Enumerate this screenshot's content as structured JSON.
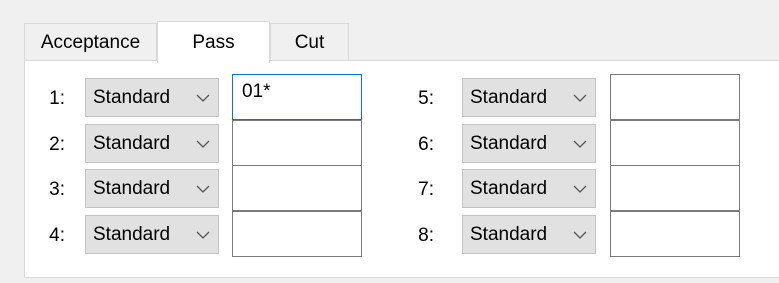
{
  "tabs": [
    {
      "label": "Acceptance",
      "selected": false
    },
    {
      "label": "Pass",
      "selected": true
    },
    {
      "label": "Cut",
      "selected": false
    }
  ],
  "left_rows": [
    {
      "label": "1:",
      "type": "Standard",
      "value": "01*"
    },
    {
      "label": "2:",
      "type": "Standard",
      "value": ""
    },
    {
      "label": "3:",
      "type": "Standard",
      "value": ""
    },
    {
      "label": "4:",
      "type": "Standard",
      "value": ""
    }
  ],
  "right_rows": [
    {
      "label": "5:",
      "type": "Standard",
      "value": ""
    },
    {
      "label": "6:",
      "type": "Standard",
      "value": ""
    },
    {
      "label": "7:",
      "type": "Standard",
      "value": ""
    },
    {
      "label": "8:",
      "type": "Standard",
      "value": ""
    }
  ],
  "icons": {
    "dropdown": "chevron-down-icon"
  },
  "colors": {
    "focus": "#0078d7",
    "combo_bg": "#e1e1e1",
    "window_bg": "#f0f0f0"
  }
}
